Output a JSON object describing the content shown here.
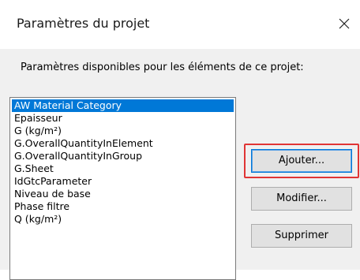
{
  "dialog": {
    "title": "Paramètres du projet",
    "close_glyph": "×"
  },
  "intro": {
    "label": "Paramètres disponibles pour les éléments de ce projet:"
  },
  "parameters": {
    "selected_index": 0,
    "items": [
      "AW Material Category",
      "Epaisseur",
      "G (kg/m²)",
      "G.OverallQuantityInElement",
      "G.OverallQuantityInGroup",
      "G.Sheet",
      "IdGtcParameter",
      "Niveau de base",
      "Phase filtre",
      "Q (kg/m²)"
    ]
  },
  "buttons": {
    "add": "Ajouter...",
    "modify": "Modifier...",
    "delete": "Supprimer"
  },
  "colors": {
    "selection": "#0078d7",
    "highlight_frame": "#e03535"
  }
}
